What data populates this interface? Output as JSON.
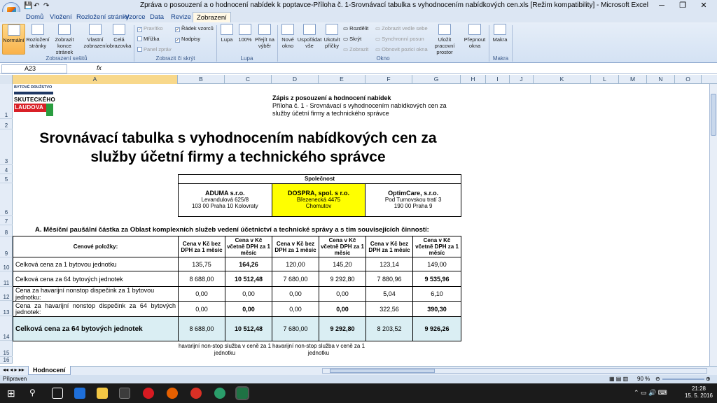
{
  "window": {
    "title": "Zpráva o posouzení a o hodnocení nabídek k poptavce-Příloha č. 1-Srovnávací tabulka s vyhodnocením nabídkových cen.xls [Režim kompatibility] - Microsoft Excel"
  },
  "tabs": [
    "Domů",
    "Vložení",
    "Rozložení stránky",
    "Vzorce",
    "Data",
    "Revize",
    "Zobrazení"
  ],
  "active_tab": "Zobrazení",
  "ribbon": {
    "views": [
      "Normální",
      "Rozložení stránky",
      "Zobrazit konce stránek",
      "Vlastní zobrazení",
      "Celá obrazovka"
    ],
    "show": [
      "Pravítko",
      "Mřížka",
      "Panel zpráv",
      "Řádek vzorců",
      "Nadpisy"
    ],
    "zoom": [
      "Lupa",
      "100%",
      "Přejít na výběr"
    ],
    "window": [
      "Nové okno",
      "Uspořádat vše",
      "Ukotvit příčky",
      "Rozdělit",
      "Skrýt",
      "Zobrazit",
      "Zobrazit vedle sebe",
      "Synchronní posun",
      "Obnovit pozici okna",
      "Uložit pracovní prostor",
      "Přepnout okna"
    ],
    "macros": [
      "Makra"
    ],
    "groups": [
      "Zobrazení sešitů",
      "Zobrazit či skrýt",
      "Lupa",
      "Okno",
      "Makra"
    ]
  },
  "formula_bar": {
    "name_box": "A23",
    "fx": "fx",
    "value": ""
  },
  "columns": [
    "A",
    "B",
    "C",
    "D",
    "E",
    "F",
    "G",
    "H",
    "I",
    "J",
    "K",
    "L",
    "M",
    "N",
    "O"
  ],
  "rows": [
    "1",
    "2",
    "3",
    "4",
    "5",
    "6",
    "7",
    "8",
    "9",
    "10",
    "11",
    "12",
    "13",
    "14",
    "15",
    "16"
  ],
  "logo": {
    "line1": "BYTOVÉ DRUŽSTVO",
    "line2": "SKUTECKÉHO",
    "line3": "LAUDOVA"
  },
  "header": {
    "line1": "Zápis z posouzení a hodnocení nabídek",
    "line2": "Příloha č. 1 - Srovnávací s vyhodnocením nabídkových cen za",
    "line3": "služby účetní firmy a technického správce"
  },
  "main_title": {
    "line1": "Srovnávací tabulka s vyhodnocením nabídkových cen za",
    "line2": "služby účetní firmy a technického správce"
  },
  "companies": {
    "heading": "Společnost",
    "list": [
      {
        "name": "ADUMA s.r.o.",
        "street": "Levandulová 625/8",
        "city": "103 00 Praha 10 Kolovraty"
      },
      {
        "name": "DOSPRA, spol. s r.o.",
        "street": "Březenecká 4475",
        "city": "Chomutov"
      },
      {
        "name": "OptimCare, s.r.o.",
        "street": "Pod Turnovskou tratí 3",
        "city": "190 00 Praha 9"
      }
    ],
    "highlight_color": "#ffff00"
  },
  "section_a": "A. Měsíční paušální částka za Oblast komplexních služeb vedení účetnictví a technické správy a s tím souvisejících činností:",
  "price_table": {
    "headers": [
      "Cenové položky:",
      "Cena v Kč bez DPH za 1 měsíc",
      "Cena v Kč včetně DPH za 1 měsíc",
      "Cena v Kč bez DPH za 1 měsíc",
      "Cena v Kč včetně DPH za 1 měsíc",
      "Cena v Kč bez DPH za 1 měsíc",
      "Cena v Kč včetně DPH za 1 měsíc"
    ],
    "rows": [
      [
        "Celková cena za 1 bytovou jednotku",
        "135,75",
        "164,26",
        "120,00",
        "145,20",
        "123,14",
        "149,00"
      ],
      [
        "Celková cena za 64 bytových jednotek",
        "8 688,00",
        "10 512,48",
        "7 680,00",
        "9 292,80",
        "7 880,96",
        "9 535,96"
      ],
      [
        "Cena za havarijní nonstop dispečink za 1 bytovou jednotku:",
        "0,00",
        "0,00",
        "0,00",
        "0,00",
        "5,04",
        "6,10"
      ],
      [
        "Cena za havarijní nonstop dispečink za 64 bytových jednotek:",
        "0,00",
        "0,00",
        "0,00",
        "0,00",
        "322,56",
        "390,30"
      ],
      [
        "Celková cena za 64 bytových jednotek",
        "8 688,00",
        "10 512,48",
        "7 680,00",
        "9 292,80",
        "8 203,52",
        "9 926,26"
      ]
    ],
    "total_color": "#daeef3"
  },
  "notes": [
    "havarijní non-stop služba v ceně za 1 jednotku",
    "havarijní non-stop služba v ceně za 1 jednotku"
  ],
  "sheet_tab": "Hodnocení",
  "status": {
    "left": "Připraven",
    "zoom": "90 %"
  },
  "clock": {
    "time": "21:28",
    "date": "15. 5. 2016"
  }
}
